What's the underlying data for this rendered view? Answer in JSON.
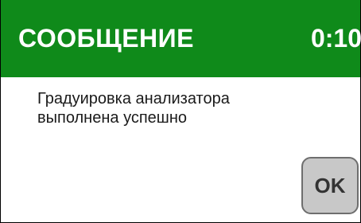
{
  "header": {
    "title": "СООБЩЕНИЕ",
    "timer": "0:10",
    "color": "#0f8a1a"
  },
  "message": {
    "line1": "Градуировка анализатора",
    "line2": "выполнена успешно"
  },
  "actions": {
    "ok_label": "OK"
  }
}
